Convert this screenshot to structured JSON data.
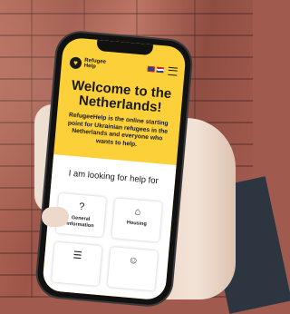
{
  "app": {
    "logo_text": "Refugee\nHelp",
    "logo_glyph": "♥"
  },
  "hero": {
    "title": "Welcome to the Netherlands!",
    "text": "RefugeeHelp is the online starting point for Ukrainian refugees in the Netherlands and everyone who wants to help."
  },
  "help": {
    "heading": "I am looking for help for",
    "cards": [
      {
        "label": "General information",
        "icon": "question-icon",
        "glyph": "?"
      },
      {
        "label": "Housing",
        "icon": "house-icon",
        "glyph": "⌂"
      },
      {
        "label": "",
        "icon": "document-icon",
        "glyph": "☰"
      },
      {
        "label": "",
        "icon": "people-icon",
        "glyph": "☺"
      }
    ]
  },
  "colors": {
    "brand_yellow": "#fbd038",
    "text_dark": "#1a1a1a",
    "brick": "#a05a4e"
  }
}
